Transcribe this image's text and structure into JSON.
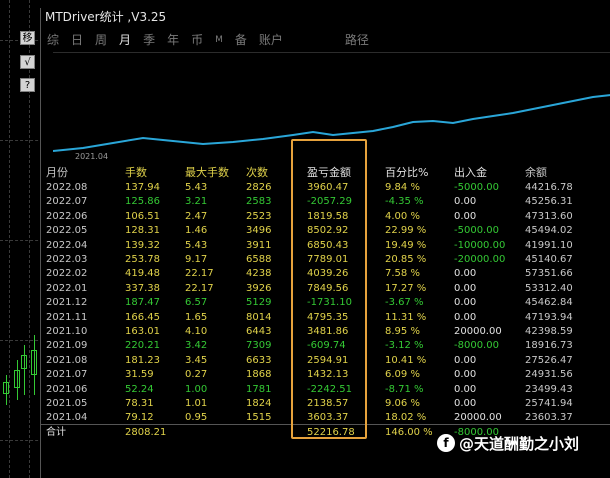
{
  "window": {
    "title": "MTDriver统计 ,V3.25"
  },
  "side_buttons": [
    "移",
    "√",
    "?"
  ],
  "tabs": [
    {
      "label": "综",
      "active": false
    },
    {
      "label": "日",
      "active": false
    },
    {
      "label": "周",
      "active": false
    },
    {
      "label": "月",
      "active": true
    },
    {
      "label": "季",
      "active": false
    },
    {
      "label": "年",
      "active": false
    },
    {
      "label": "币",
      "active": false
    },
    {
      "label": "M",
      "active": false
    },
    {
      "label": "备",
      "active": false
    },
    {
      "label": "账户",
      "active": false
    },
    {
      "label": "路径",
      "active": false
    }
  ],
  "chart": {
    "x_start_label": "2021.04",
    "line_color": "#2aa6d8"
  },
  "table": {
    "headers": [
      "月份",
      "手数",
      "最大手数",
      "次数",
      "盈亏金额",
      "百分比%",
      "出入金",
      "余额"
    ],
    "rows": [
      [
        "2022.08",
        "137.94",
        "5.43",
        "2826",
        "3960.47",
        "9.84 %",
        "-5000.00",
        "44216.78"
      ],
      [
        "2022.07",
        "125.86",
        "3.21",
        "2583",
        "-2057.29",
        "-4.35 %",
        "0.00",
        "45256.31"
      ],
      [
        "2022.06",
        "106.51",
        "2.47",
        "2523",
        "1819.58",
        "4.00 %",
        "0.00",
        "47313.60"
      ],
      [
        "2022.05",
        "128.31",
        "1.46",
        "3496",
        "8502.92",
        "22.99 %",
        "-5000.00",
        "45494.02"
      ],
      [
        "2022.04",
        "139.32",
        "5.43",
        "3911",
        "6850.43",
        "19.49 %",
        "-10000.00",
        "41991.10"
      ],
      [
        "2022.03",
        "253.78",
        "9.17",
        "6588",
        "7789.01",
        "20.85 %",
        "-20000.00",
        "45140.67"
      ],
      [
        "2022.02",
        "419.48",
        "22.17",
        "4238",
        "4039.26",
        "7.58 %",
        "0.00",
        "57351.66"
      ],
      [
        "2022.01",
        "337.38",
        "22.17",
        "3926",
        "7849.56",
        "17.27 %",
        "0.00",
        "53312.40"
      ],
      [
        "2021.12",
        "187.47",
        "6.57",
        "5129",
        "-1731.10",
        "-3.67 %",
        "0.00",
        "45462.84"
      ],
      [
        "2021.11",
        "166.45",
        "1.65",
        "8014",
        "4795.35",
        "11.31 %",
        "0.00",
        "47193.94"
      ],
      [
        "2021.10",
        "163.01",
        "4.10",
        "6443",
        "3481.86",
        "8.95 %",
        "20000.00",
        "42398.59"
      ],
      [
        "2021.09",
        "220.21",
        "3.42",
        "7309",
        "-609.74",
        "-3.12 %",
        "-8000.00",
        "18916.73"
      ],
      [
        "2021.08",
        "181.23",
        "3.45",
        "6633",
        "2594.91",
        "10.41 %",
        "0.00",
        "27526.47"
      ],
      [
        "2021.07",
        "31.59",
        "0.27",
        "1868",
        "1432.13",
        "6.09 %",
        "0.00",
        "24931.56"
      ],
      [
        "2021.06",
        "52.24",
        "1.00",
        "1781",
        "-2242.51",
        "-8.71 %",
        "0.00",
        "23499.43"
      ],
      [
        "2021.05",
        "78.31",
        "1.01",
        "1824",
        "2138.57",
        "9.06 %",
        "0.00",
        "25741.94"
      ],
      [
        "2021.04",
        "79.12",
        "0.95",
        "1515",
        "3603.37",
        "18.02 %",
        "20000.00",
        "23603.37"
      ]
    ],
    "total": [
      "合计",
      "2808.21",
      "",
      "",
      "52216.78",
      "146.00 %",
      "-8000.00",
      ""
    ]
  },
  "watermark": {
    "icon": "f",
    "text": "@天道酬勤之小刘"
  },
  "colors": {
    "positive": "#e0d24a",
    "negative": "#34c934",
    "highlight": "#e6a23c"
  }
}
